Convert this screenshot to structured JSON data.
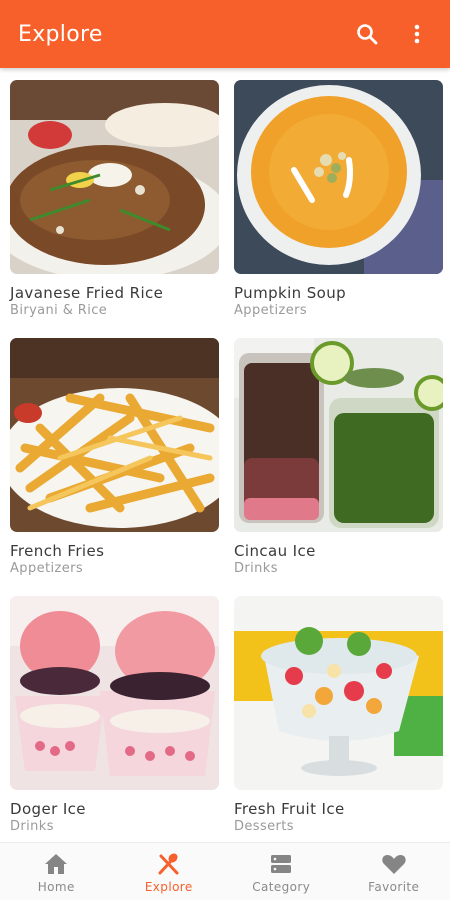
{
  "app": {
    "title": "Explore",
    "accent_color": "#f7602b",
    "actions": [
      {
        "icon": "search-icon"
      },
      {
        "icon": "more-vertical-icon"
      }
    ]
  },
  "recipes": [
    {
      "name": "Javanese Fried Rice",
      "category": "Biryani & Rice",
      "image": "fried-rice-photo"
    },
    {
      "name": "Pumpkin Soup",
      "category": "Appetizers",
      "image": "pumpkin-soup-photo"
    },
    {
      "name": "French Fries",
      "category": "Appetizers",
      "image": "french-fries-photo"
    },
    {
      "name": "Cincau Ice",
      "category": "Drinks",
      "image": "cincau-ice-photo"
    },
    {
      "name": "Doger Ice",
      "category": "Drinks",
      "image": "doger-ice-photo"
    },
    {
      "name": "Fresh Fruit Ice",
      "category": "Desserts",
      "image": "fresh-fruit-ice-photo"
    }
  ],
  "bottom_nav": {
    "active": "Explore",
    "items": [
      {
        "label": "Home",
        "icon": "home-icon"
      },
      {
        "label": "Explore",
        "icon": "utensils-icon"
      },
      {
        "label": "Category",
        "icon": "category-icon"
      },
      {
        "label": "Favorite",
        "icon": "heart-icon"
      }
    ]
  }
}
